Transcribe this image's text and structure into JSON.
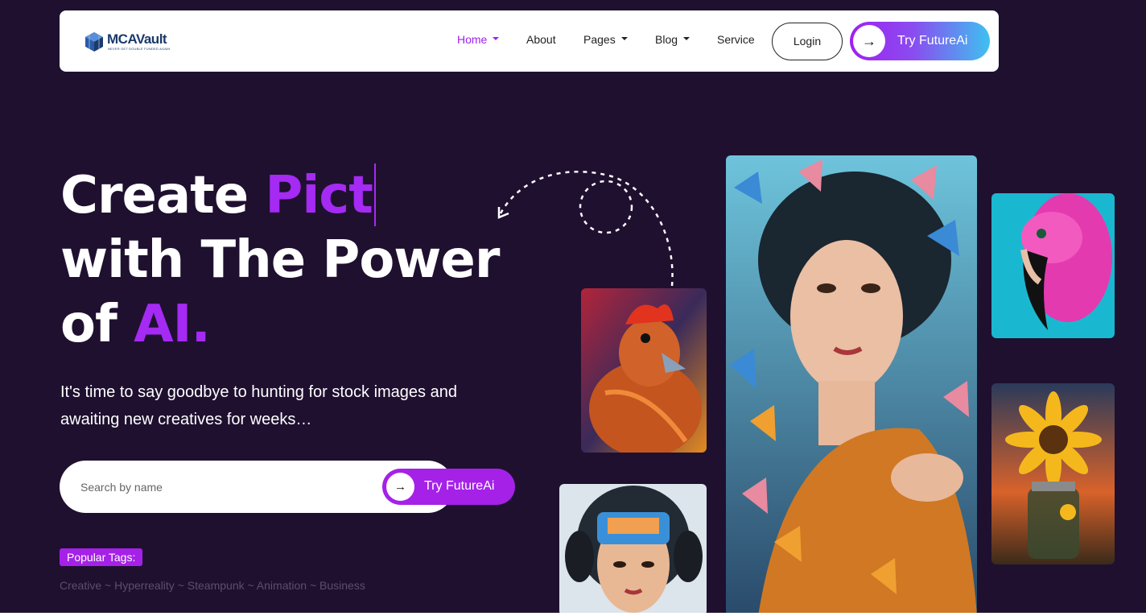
{
  "brand": {
    "name": "MCAVault",
    "tagline": "NEVER GET DOUBLE FUNDED AGAIN"
  },
  "nav": {
    "items": [
      {
        "label": "Home",
        "dropdown": true,
        "active": true
      },
      {
        "label": "About",
        "dropdown": false
      },
      {
        "label": "Pages",
        "dropdown": true
      },
      {
        "label": "Blog",
        "dropdown": true
      },
      {
        "label": "Service",
        "dropdown": false
      }
    ],
    "login_label": "Login",
    "cta_label": "Try FutureAi"
  },
  "hero": {
    "title_line1_a": "Create ",
    "title_line1_b": "Pict",
    "title_line2": "with The Power",
    "title_line3_a": "of ",
    "title_line3_b": "AI.",
    "subtitle": "It's time to say goodbye to hunting for stock images and awaiting new creatives for weeks…"
  },
  "search": {
    "placeholder": "Search by name",
    "button_label": "Try FutureAi"
  },
  "tags": {
    "label": "Popular Tags:",
    "items": [
      "Creative",
      "Hyperreality",
      "Steampunk",
      "Animation",
      "Business"
    ],
    "separator": " ~ "
  },
  "colors": {
    "background": "#1f1030",
    "accent": "#a52af3",
    "button": "#a521e8",
    "gradient_end": "#3fc0f0"
  },
  "icons": {
    "arrow": "arrow-right-icon",
    "caret": "caret-down-icon"
  }
}
